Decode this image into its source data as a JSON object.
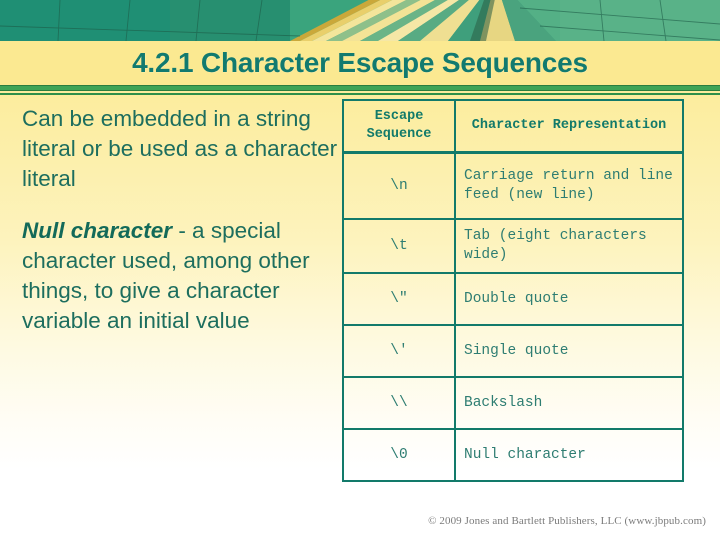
{
  "slide": {
    "title": "4.2.1 Character Escape Sequences",
    "header_image_alt": "hot-air-balloon-panels-banner"
  },
  "body": {
    "paragraph1": "Can be embedded in a string literal or be used as a character literal",
    "paragraph2_emphasis": "Null character",
    "paragraph2_rest": " - a special character used, among other things, to give a character variable an initial value"
  },
  "table": {
    "headers": {
      "escape_sequence": "Escape Sequence",
      "character_representation": "Character Representation"
    },
    "rows": [
      {
        "sequence": "\\n",
        "representation": "Carriage return and line feed (new line)"
      },
      {
        "sequence": "\\t",
        "representation": "Tab (eight characters wide)"
      },
      {
        "sequence": "\\\"",
        "representation": "Double quote"
      },
      {
        "sequence": "\\'",
        "representation": "Single quote"
      },
      {
        "sequence": "\\\\",
        "representation": "Backslash"
      },
      {
        "sequence": "\\0",
        "representation": "Null character"
      }
    ]
  },
  "footer": {
    "copyright": "© 2009 Jones and Bartlett Publishers, LLC (www.jbpub.com)"
  },
  "colors": {
    "title": "#127a6f",
    "body_text": "#1d6e5e",
    "table_border": "#127a6a",
    "rule": "#3fa457",
    "background_top": "#f9e88c",
    "background_bottom": "#ffffff",
    "footer_text": "#7b7b7b"
  }
}
